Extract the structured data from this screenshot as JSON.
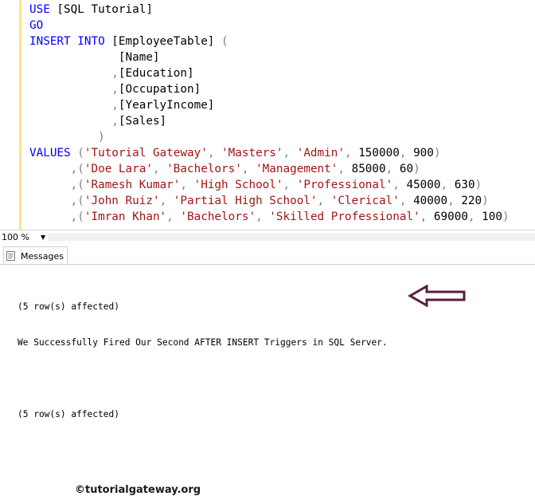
{
  "editor": {
    "lines": [
      {
        "parts": [
          {
            "t": "USE",
            "c": "kw"
          },
          {
            "t": " [SQL Tutorial]",
            "c": ""
          }
        ]
      },
      {
        "parts": [
          {
            "t": "GO",
            "c": "kw"
          }
        ]
      },
      {
        "parts": [
          {
            "t": "INSERT INTO",
            "c": "kw"
          },
          {
            "t": " [EmployeeTable] ",
            "c": ""
          },
          {
            "t": "(",
            "c": "op"
          }
        ]
      },
      {
        "parts": [
          {
            "t": "             [Name]",
            "c": ""
          }
        ]
      },
      {
        "parts": [
          {
            "t": "            ",
            "c": ""
          },
          {
            "t": ",",
            "c": "op"
          },
          {
            "t": "[Education]",
            "c": ""
          }
        ]
      },
      {
        "parts": [
          {
            "t": "            ",
            "c": ""
          },
          {
            "t": ",",
            "c": "op"
          },
          {
            "t": "[Occupation]",
            "c": ""
          }
        ]
      },
      {
        "parts": [
          {
            "t": "            ",
            "c": ""
          },
          {
            "t": ",",
            "c": "op"
          },
          {
            "t": "[YearlyIncome]",
            "c": ""
          }
        ]
      },
      {
        "parts": [
          {
            "t": "            ",
            "c": ""
          },
          {
            "t": ",",
            "c": "op"
          },
          {
            "t": "[Sales]",
            "c": ""
          }
        ]
      },
      {
        "parts": [
          {
            "t": "          ",
            "c": ""
          },
          {
            "t": ")",
            "c": "op"
          }
        ]
      },
      {
        "parts": [
          {
            "t": "VALUES",
            "c": "kw"
          },
          {
            "t": " ",
            "c": ""
          },
          {
            "t": "(",
            "c": "op"
          },
          {
            "t": "'Tutorial Gateway'",
            "c": "str"
          },
          {
            "t": ", ",
            "c": "op"
          },
          {
            "t": "'Masters'",
            "c": "str"
          },
          {
            "t": ", ",
            "c": "op"
          },
          {
            "t": "'Admin'",
            "c": "str"
          },
          {
            "t": ", ",
            "c": "op"
          },
          {
            "t": "150000",
            "c": "num"
          },
          {
            "t": ", ",
            "c": "op"
          },
          {
            "t": "900",
            "c": "num"
          },
          {
            "t": ")",
            "c": "op"
          }
        ]
      },
      {
        "parts": [
          {
            "t": "      ",
            "c": ""
          },
          {
            "t": ",(",
            "c": "op"
          },
          {
            "t": "'Doe Lara'",
            "c": "str"
          },
          {
            "t": ", ",
            "c": "op"
          },
          {
            "t": "'Bachelors'",
            "c": "str"
          },
          {
            "t": ", ",
            "c": "op"
          },
          {
            "t": "'Management'",
            "c": "str"
          },
          {
            "t": ", ",
            "c": "op"
          },
          {
            "t": "85000",
            "c": "num"
          },
          {
            "t": ", ",
            "c": "op"
          },
          {
            "t": "60",
            "c": "num"
          },
          {
            "t": ")",
            "c": "op"
          }
        ]
      },
      {
        "parts": [
          {
            "t": "      ",
            "c": ""
          },
          {
            "t": ",(",
            "c": "op"
          },
          {
            "t": "'Ramesh Kumar'",
            "c": "str"
          },
          {
            "t": ", ",
            "c": "op"
          },
          {
            "t": "'High School'",
            "c": "str"
          },
          {
            "t": ", ",
            "c": "op"
          },
          {
            "t": "'Professional'",
            "c": "str"
          },
          {
            "t": ", ",
            "c": "op"
          },
          {
            "t": "45000",
            "c": "num"
          },
          {
            "t": ", ",
            "c": "op"
          },
          {
            "t": "630",
            "c": "num"
          },
          {
            "t": ")",
            "c": "op"
          }
        ]
      },
      {
        "parts": [
          {
            "t": "      ",
            "c": ""
          },
          {
            "t": ",(",
            "c": "op"
          },
          {
            "t": "'John Ruiz'",
            "c": "str"
          },
          {
            "t": ", ",
            "c": "op"
          },
          {
            "t": "'Partial High School'",
            "c": "str"
          },
          {
            "t": ", ",
            "c": "op"
          },
          {
            "t": "'Clerical'",
            "c": "str"
          },
          {
            "t": ", ",
            "c": "op"
          },
          {
            "t": "40000",
            "c": "num"
          },
          {
            "t": ", ",
            "c": "op"
          },
          {
            "t": "220",
            "c": "num"
          },
          {
            "t": ")",
            "c": "op"
          }
        ]
      },
      {
        "parts": [
          {
            "t": "      ",
            "c": ""
          },
          {
            "t": ",(",
            "c": "op"
          },
          {
            "t": "'Imran Khan'",
            "c": "str"
          },
          {
            "t": ", ",
            "c": "op"
          },
          {
            "t": "'Bachelors'",
            "c": "str"
          },
          {
            "t": ", ",
            "c": "op"
          },
          {
            "t": "'Skilled Professional'",
            "c": "str"
          },
          {
            "t": ", ",
            "c": "op"
          },
          {
            "t": "69000",
            "c": "num"
          },
          {
            "t": ", ",
            "c": "op"
          },
          {
            "t": "100",
            "c": "num"
          },
          {
            "t": ")",
            "c": "op"
          }
        ]
      }
    ]
  },
  "status": {
    "zoom": "100 %"
  },
  "results": {
    "messages_tab_label": "Messages",
    "watermark": "©tutorialgateway.org",
    "messages": [
      "(5 row(s) affected)",
      "We Successfully Fired Our Second AFTER INSERT Triggers in SQL Server.",
      "",
      "(5 row(s) affected)"
    ]
  },
  "colors": {
    "keyword": "#0000ff",
    "string": "#a31515",
    "operator": "#808080",
    "gutter_marker": "#f7e68a",
    "arrow": "#5a1e3c"
  },
  "icons": {
    "messages_tab": "messages-icon",
    "annotation": "arrow-left-icon"
  }
}
